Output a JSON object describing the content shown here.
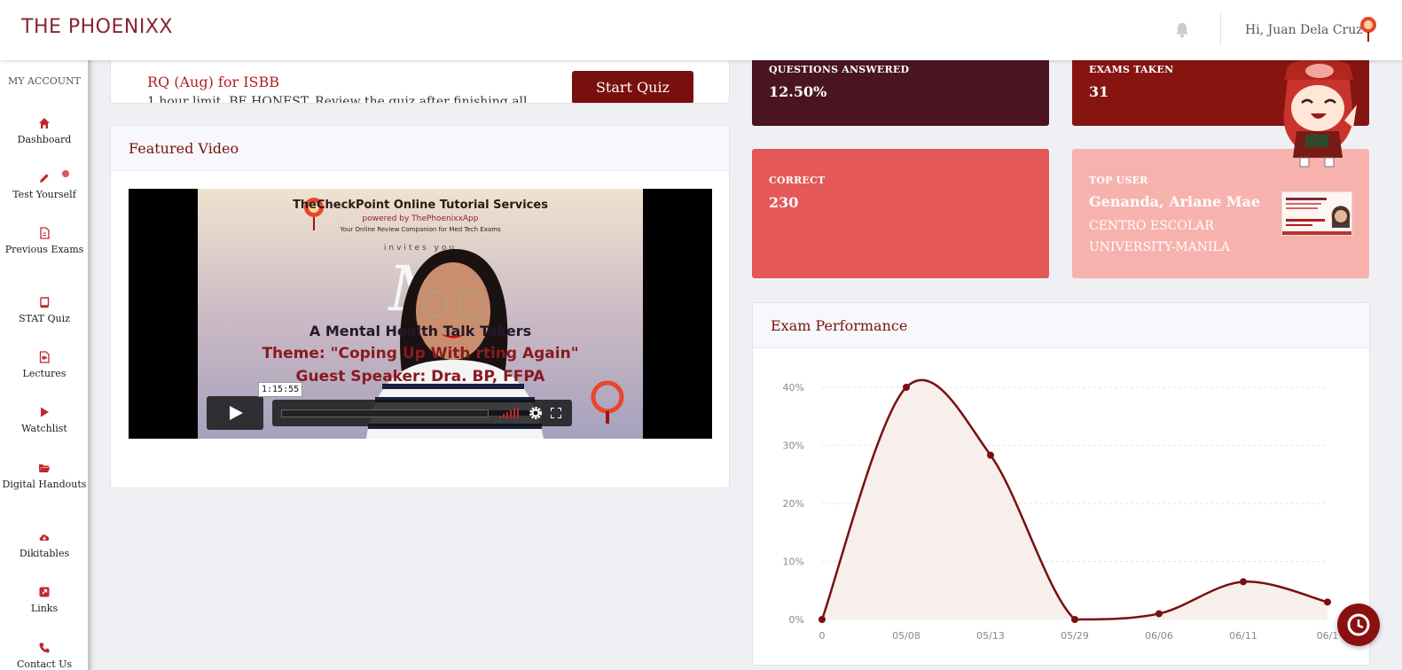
{
  "header": {
    "logo_text": "THE PHOENIXX",
    "greeting": "Hi, Juan Dela Cruz"
  },
  "sidebar": {
    "account_label": "MY ACCOUNT",
    "items": [
      {
        "label": "Dashboard",
        "icon": "home-icon"
      },
      {
        "label": "Test Yourself",
        "icon": "pencil-icon"
      },
      {
        "label": "Previous Exams",
        "icon": "document-icon"
      },
      {
        "label": "STAT Quiz",
        "icon": "book-icon"
      },
      {
        "label": "Lectures",
        "icon": "video-file-icon"
      },
      {
        "label": "Watchlist",
        "icon": "play-icon"
      },
      {
        "label": "Digital Handouts",
        "icon": "folder-open-icon"
      },
      {
        "label": "Dikitables",
        "icon": "cloud-download-icon"
      },
      {
        "label": "Links",
        "icon": "external-link-icon"
      },
      {
        "label": "Contact Us",
        "icon": "phone-icon"
      }
    ]
  },
  "quiz": {
    "title": "RQ (Aug) for ISBB",
    "description": "1 hour limit. BE HONEST. Review the quiz after finishing all",
    "button": "Start Quiz"
  },
  "video": {
    "heading": "Featured Video",
    "frame_title": "TheCheckPoint Online Tutorial Services",
    "frame_powered": "powered by ThePhoenixxApp",
    "frame_sub": "Your Online Review Companion for Med Tech Exams",
    "frame_invites": "invites you",
    "frame_m": "M",
    "frame_talk": "A Mental Health Talk                    Takers",
    "frame_theme": "Theme: \"Coping Up With                      rting Again\"",
    "frame_speaker": "Guest Speaker: Dra.                                  BP, FFPA",
    "timestamp": "1:15:55"
  },
  "stats": {
    "questions_answered_label": "QUESTIONS ANSWERED",
    "questions_answered": "12.50%",
    "exams_taken_label": "EXAMS TAKEN",
    "exams_taken": "31",
    "correct_label": "CORRECT",
    "correct": "230",
    "top_user_label": "TOP USER",
    "top_user_name": "Genanda, Ariane Mae",
    "top_user_school": "CENTRO ESCOLAR UNIVERSITY-MANILA"
  },
  "performance": {
    "heading": "Exam Performance"
  },
  "chart_data": {
    "type": "area",
    "categories": [
      "0",
      "05/08",
      "05/13",
      "05/29",
      "06/06",
      "06/11",
      "06/1"
    ],
    "values": [
      0,
      40,
      28.3,
      0,
      1,
      6.5,
      3
    ],
    "yticks": [
      "0%",
      "10%",
      "20%",
      "30%",
      "40%"
    ],
    "ylim": [
      0,
      40
    ],
    "grid": true,
    "line_color": "#7a0f0f",
    "fill_color": "#f7efec"
  },
  "colors": {
    "brand": "#7a0f0f",
    "tile_dark": "#4a1420",
    "tile_red": "#861512",
    "tile_coral": "#e45858",
    "tile_pink": "#f8b2ad"
  }
}
